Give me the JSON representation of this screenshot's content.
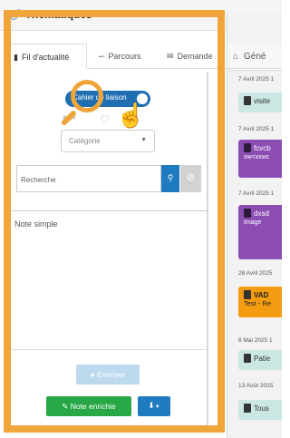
{
  "header": {
    "title": "Thématiques",
    "link_icon": "link-icon"
  },
  "tabs": [
    {
      "label": "Fil d'actualité",
      "icon": "notebook-icon",
      "active": true
    },
    {
      "label": "Parcours",
      "icon": "route-icon",
      "active": false
    },
    {
      "label": "Demande",
      "icon": "envelope-icon",
      "active": false
    },
    {
      "label": "Géné",
      "icon": "home-icon",
      "active": false
    }
  ],
  "form": {
    "toggle_label": "Cahier de liaison",
    "category_placeholder": "Catégorie",
    "search_placeholder": "Recherche",
    "note_placeholder": "Note simple",
    "send_label": "Envoyer",
    "note_enriched_label": "Note enrichie"
  },
  "timeline": [
    {
      "date": "7 Avril 2025 1",
      "text": "visite",
      "color": "teal"
    },
    {
      "date": "7 Avril 2025 1",
      "text": "fcvcb",
      "text2": "xw<xxwc",
      "color": "purple"
    },
    {
      "date": "7 Avril 2025 1",
      "text": "dxsd",
      "text2": "Image",
      "color": "purple"
    },
    {
      "date": "28 Avril 2025",
      "text": "VAD",
      "text2": "Test - Re",
      "color": "orange"
    },
    {
      "date": "6 Mai 2025 1",
      "text": "Patie",
      "color": "teal"
    },
    {
      "date": "13 Août 2025",
      "text": "Tous",
      "color": "teal"
    }
  ],
  "colors": {
    "highlight": "#f0a53a",
    "primary": "#1e7bbf",
    "success": "#27a745",
    "purple": "#8c4db3",
    "teal": "#cbe7e4"
  }
}
